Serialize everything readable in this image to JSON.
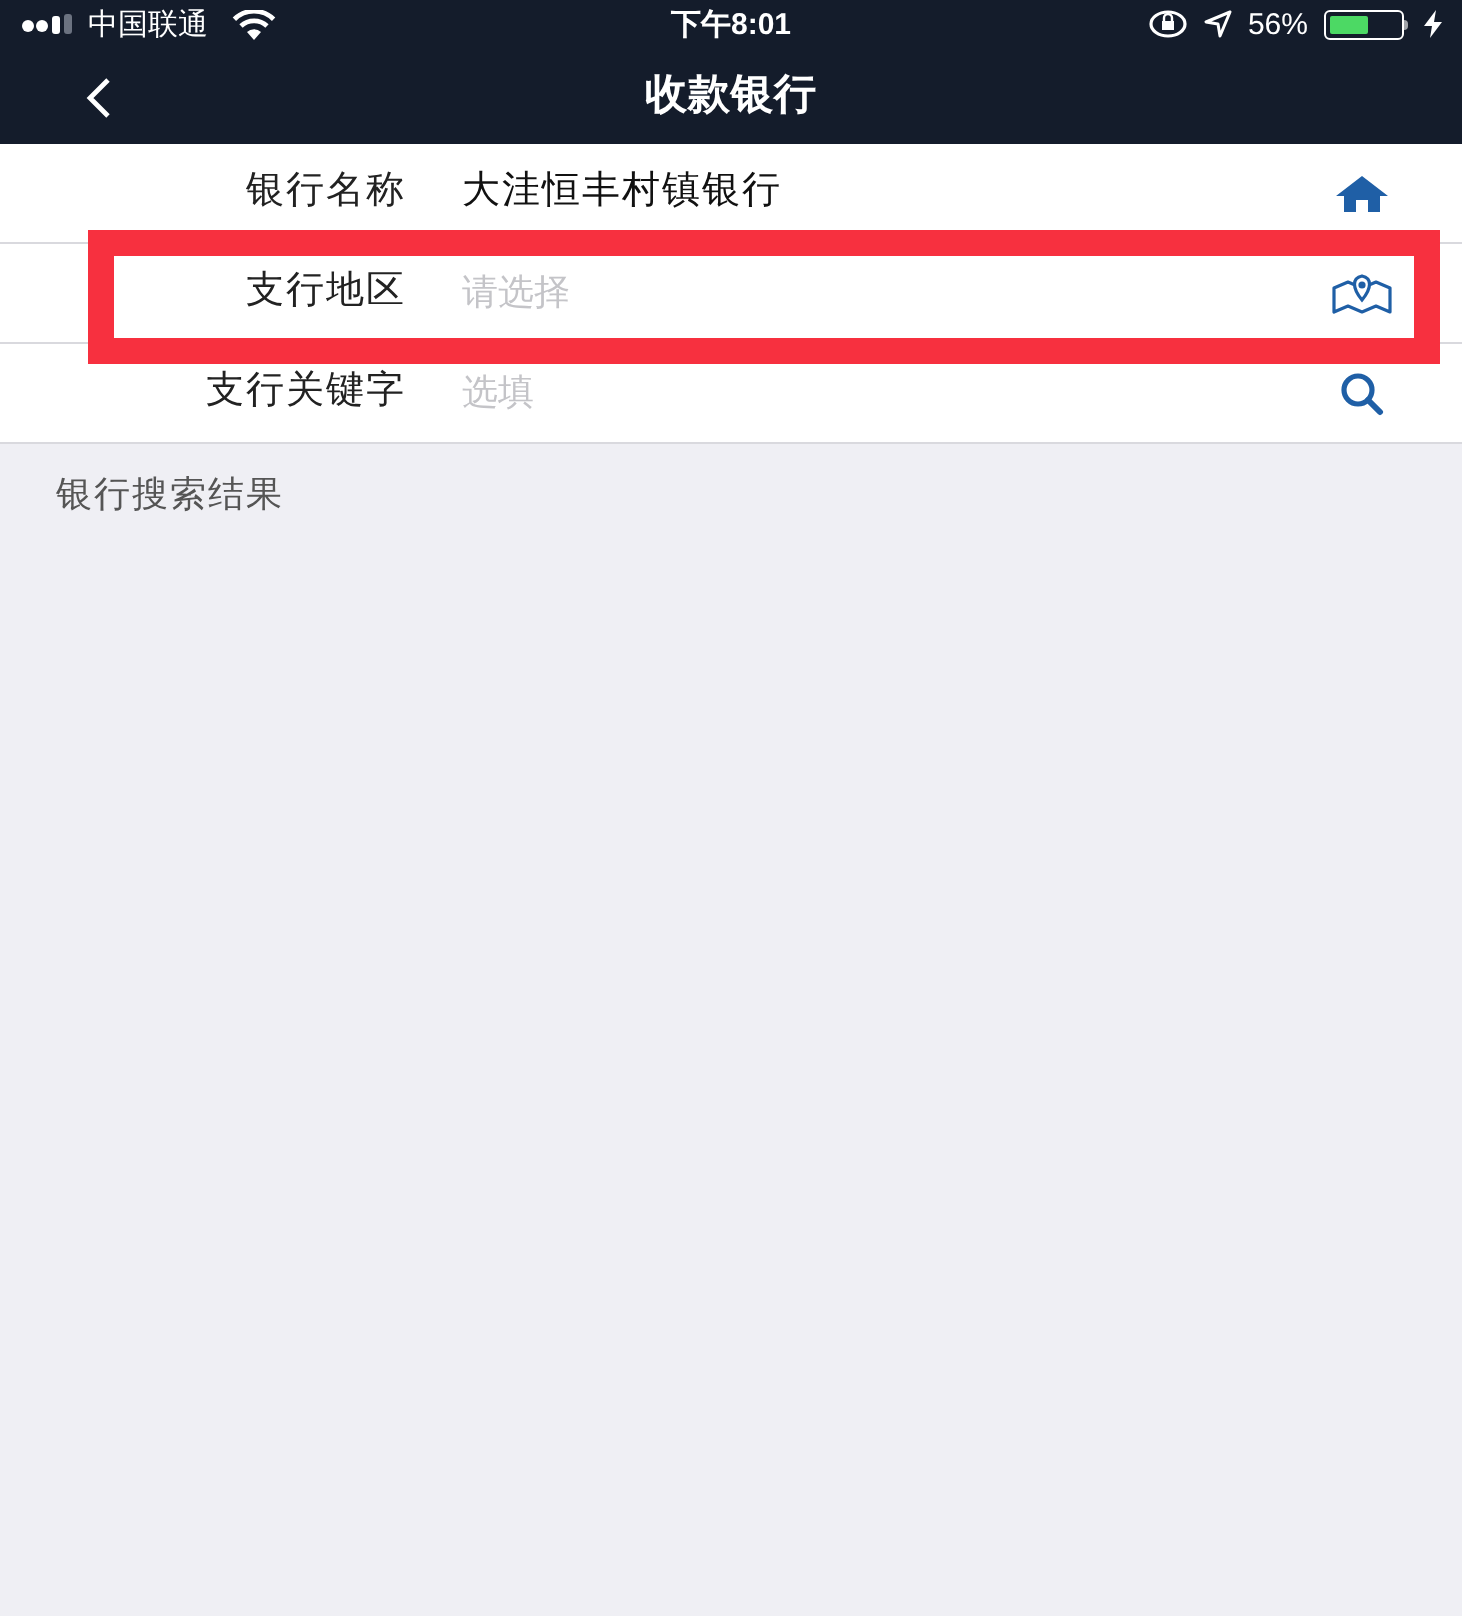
{
  "status_bar": {
    "carrier": "中国联通",
    "time": "下午8:01",
    "battery_percent": "56%",
    "battery": {
      "level": 0.56,
      "charging": true
    }
  },
  "nav": {
    "title": "收款银行"
  },
  "rows": [
    {
      "label": "银行名称",
      "value": "大洼恒丰村镇银行",
      "highlighted": false
    },
    {
      "label": "支行地区",
      "placeholder": "请选择",
      "highlighted": true
    },
    {
      "label": "支行关键字",
      "placeholder": "选填",
      "highlighted": false
    }
  ],
  "results_header": "银行搜索结果"
}
